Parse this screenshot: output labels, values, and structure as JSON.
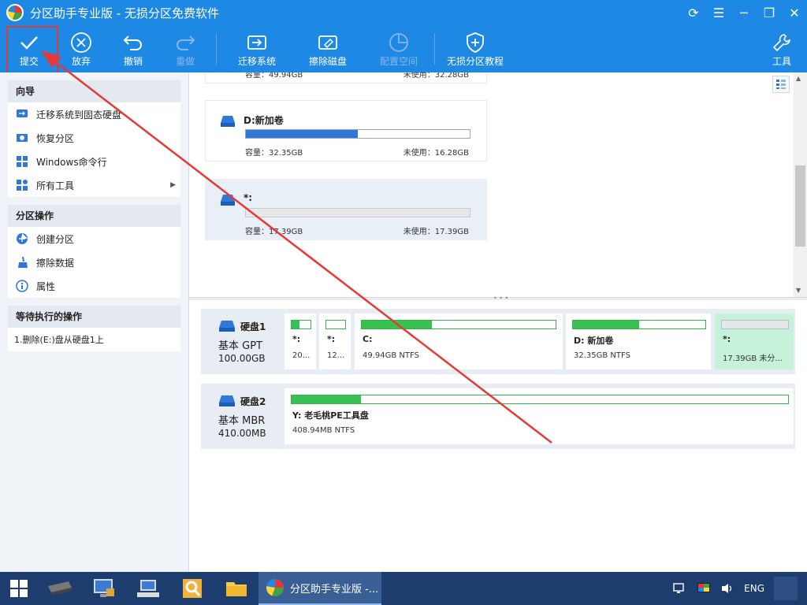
{
  "window": {
    "title": "分区助手专业版 - 无损分区免费软件"
  },
  "window_controls": {
    "refresh": "⟳",
    "menu": "☰",
    "minimize": "─",
    "restore": "❐",
    "close": "✕"
  },
  "toolbar": {
    "submit": "提交",
    "discard": "放弃",
    "undo": "撤销",
    "redo": "重做",
    "migrate": "迁移系统",
    "wipe": "擦除磁盘",
    "alloc": "配置空间",
    "tutorial": "无损分区教程",
    "tools": "工具"
  },
  "sidebar": {
    "wizard": {
      "title": "向导",
      "items": [
        "迁移系统到固态硬盘",
        "恢复分区",
        "Windows命令行",
        "所有工具"
      ]
    },
    "ops": {
      "title": "分区操作",
      "items": [
        "创建分区",
        "擦除数据",
        "属性"
      ]
    },
    "pending": {
      "title": "等待执行的操作",
      "items": [
        "1.删除(E:)盘从硬盘1上"
      ]
    }
  },
  "partitions": [
    {
      "title": "D:新加卷",
      "capacity": "容量：32.35GB",
      "unused": "未使用：16.28GB",
      "used_fraction": 0.5
    },
    {
      "title": "*:",
      "capacity": "容量：17.39GB",
      "unused": "未使用：17.39GB",
      "used_fraction": 0
    }
  ],
  "partial_card": {
    "capacity": "容量：49.94GB",
    "unused": "未使用：32.28GB"
  },
  "disks": [
    {
      "name": "硬盘1",
      "type": "基本 GPT",
      "size": "100.00GB",
      "parts": [
        {
          "label": "*:",
          "info": "20...",
          "used_fraction": 0.4
        },
        {
          "label": "*:",
          "info": "12...",
          "used_fraction": 0
        },
        {
          "label": "C:",
          "info": "49.94GB NTFS",
          "used_fraction": 0.36
        },
        {
          "label": "D: 新加卷",
          "info": "32.35GB NTFS",
          "used_fraction": 0.5
        },
        {
          "label": "*:",
          "info": "17.39GB 未分...",
          "used_fraction": 0
        }
      ]
    },
    {
      "name": "硬盘2",
      "type": "基本 MBR",
      "size": "410.00MB",
      "parts": [
        {
          "label": "Y: 老毛桃PE工具盘",
          "info": "408.94MB NTFS",
          "used_fraction": 0.14
        }
      ]
    }
  ],
  "taskbar": {
    "active_app": "分区助手专业版 -...",
    "lang": "ENG"
  },
  "colors": {
    "accent": "#1e88e5",
    "used_bar": "#37c152",
    "highlight": "#e53935"
  }
}
